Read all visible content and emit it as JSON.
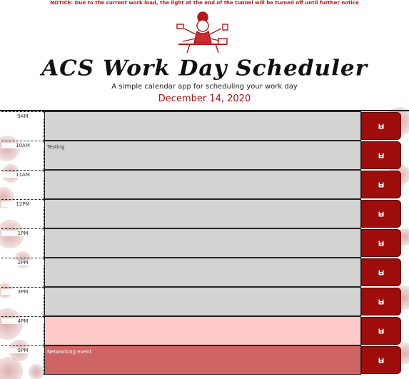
{
  "notice": "NOTICE: Due to the current work load, the light at the end of the tunnel will be turned off until further notice",
  "header": {
    "title": "ACS Work Day Scheduler",
    "subtitle": "A simple calendar app for scheduling your work day",
    "date": "December 14, 2020"
  },
  "colors": {
    "accent": "#a31212",
    "save_button": "#9e0c0c",
    "past": "#d3d3d3",
    "present": "#ffcaca",
    "future": "#cf6464"
  },
  "save_icon": "floppy-disk-icon",
  "hours": [
    {
      "label": "9AM",
      "text": "",
      "status": "past"
    },
    {
      "label": "10AM",
      "text": "Testing",
      "status": "past"
    },
    {
      "label": "11AM",
      "text": "",
      "status": "past"
    },
    {
      "label": "12PM",
      "text": "",
      "status": "past"
    },
    {
      "label": "1PM",
      "text": "",
      "status": "past"
    },
    {
      "label": "2PM",
      "text": "",
      "status": "past"
    },
    {
      "label": "3PM",
      "text": "",
      "status": "past"
    },
    {
      "label": "4PM",
      "text": "",
      "status": "present"
    },
    {
      "label": "5PM",
      "text": "Networking event",
      "status": "future"
    }
  ]
}
